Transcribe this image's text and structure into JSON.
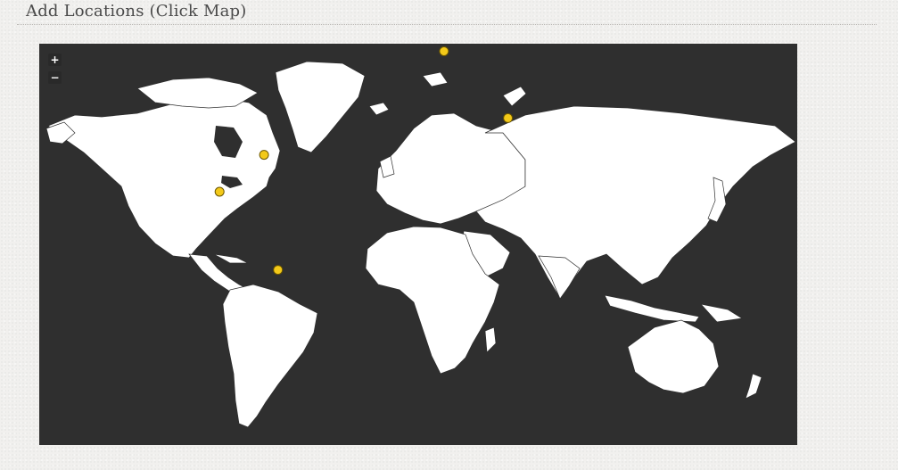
{
  "section": {
    "title": "Add Locations (Click Map)"
  },
  "map": {
    "background_color": "#2f2f2f",
    "land_color": "#ffffff",
    "border_color": "#2f2f2f",
    "marker_color": "#f3c919",
    "zoom_in_label": "+",
    "zoom_out_label": "−",
    "markers": [
      {
        "name": "northern-scandinavia",
        "lat": 69.5,
        "lon": 23.5
      },
      {
        "name": "western-russia",
        "lat": 57.5,
        "lon": 58.0
      },
      {
        "name": "quebec-canada",
        "lat": 48.5,
        "lon": -73.5
      },
      {
        "name": "central-united-states",
        "lat": 37.5,
        "lon": -97.5
      },
      {
        "name": "northern-venezuela",
        "lat": 8.5,
        "lon": -66.0
      }
    ]
  }
}
